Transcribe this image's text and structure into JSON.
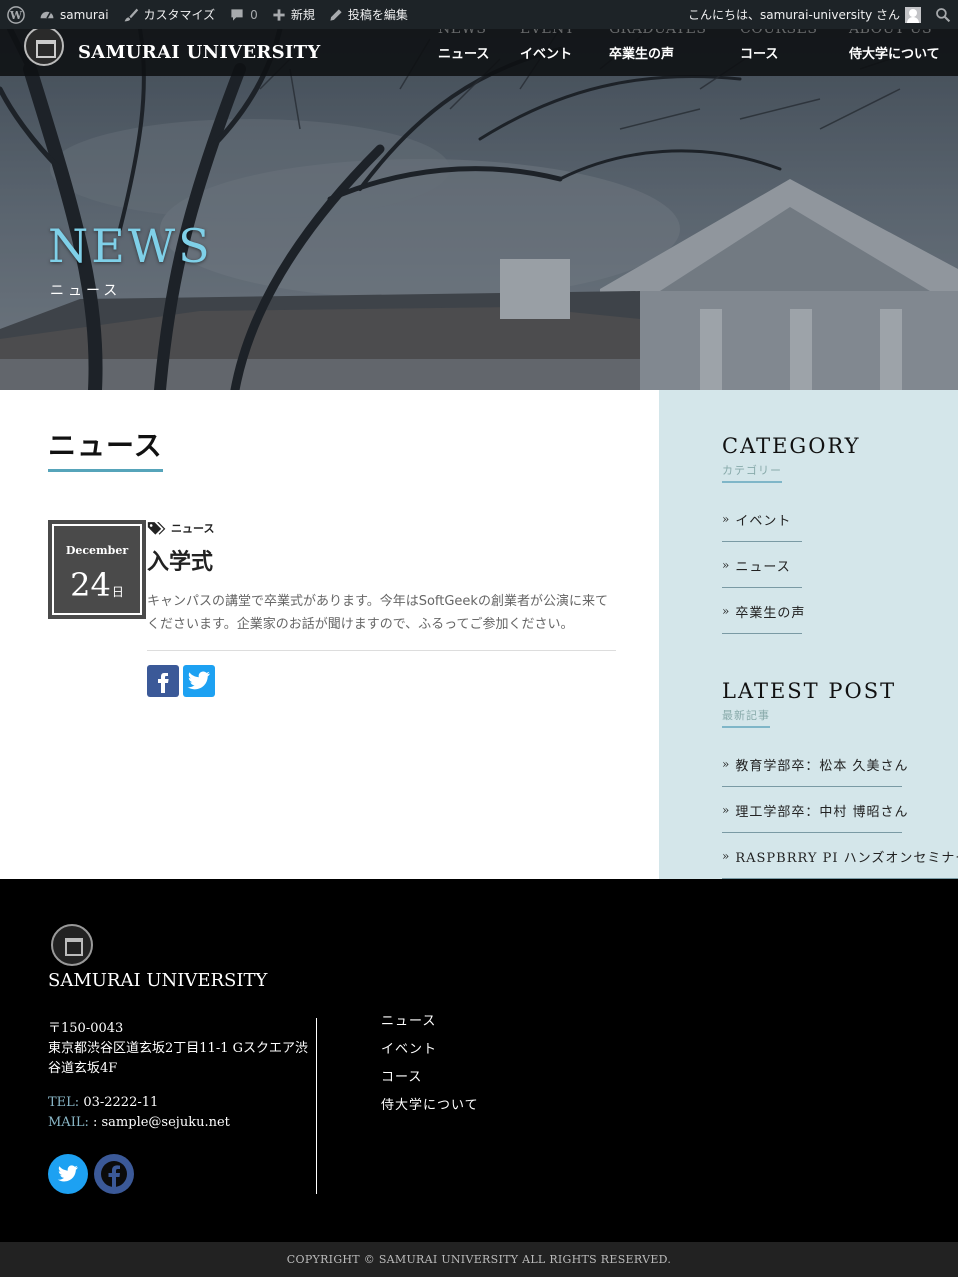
{
  "admin_bar": {
    "site_name": "samurai",
    "customize": "カスタマイズ",
    "comments_count": "0",
    "new": "新規",
    "edit_post": "投稿を編集",
    "greeting": "こんにちは、samurai-university さん"
  },
  "header": {
    "brand": "SAMURAI UNIVERSITY",
    "nav": [
      {
        "en": "NEWS",
        "jp": "ニュース"
      },
      {
        "en": "EVENT",
        "jp": "イベント"
      },
      {
        "en": "GRADUATES",
        "jp": "卒業生の声"
      },
      {
        "en": "COURSES",
        "jp": "コース"
      },
      {
        "en": "ABOUT US",
        "jp": "侍大学について"
      }
    ]
  },
  "hero": {
    "title": "NEWS",
    "subtitle": "ニュース"
  },
  "main": {
    "heading": "ニュース",
    "post": {
      "month": "December",
      "day": "24",
      "day_unit": "日",
      "category": "ニュース",
      "title": "入学式",
      "excerpt": "キャンパスの講堂で卒業式があります。今年はSoftGeekの創業者が公演に来てくださいます。企業家のお話が聞けますので、ふるってご参加ください。"
    }
  },
  "sidebar": {
    "category": {
      "title": "CATEGORY",
      "subtitle": "カテゴリー",
      "items": [
        "イベント",
        "ニュース",
        "卒業生の声"
      ]
    },
    "latest": {
      "title": "LATEST POST",
      "subtitle": "最新記事",
      "items": [
        "教育学部卒：松本 久美さん",
        "理工学部卒：中村 博昭さん",
        "RASPBRRY PI ハンズオンセミナー"
      ]
    }
  },
  "footer": {
    "name": "SAMURAI UNIVERSITY",
    "postal": "〒150-0043",
    "address": "東京都渋谷区道玄坂2丁目11-1 Gスクエア渋谷道玄坂4F",
    "tel_label": "TEL:",
    "tel": "03-2222-11",
    "mail_label": "MAIL:",
    "mail": ": sample@sejuku.net",
    "nav": [
      "ニュース",
      "イベント",
      "コース",
      "侍大学について"
    ],
    "copyright": "COPYRIGHT © SAMURAI UNIVERSITY ALL RIGHTS RESERVED."
  },
  "colors": {
    "accent": "#56a4ba",
    "hero_title": "#7fd0e8",
    "sidebar_bg": "#d4e6ea",
    "admin_bar": "#1d2327"
  }
}
